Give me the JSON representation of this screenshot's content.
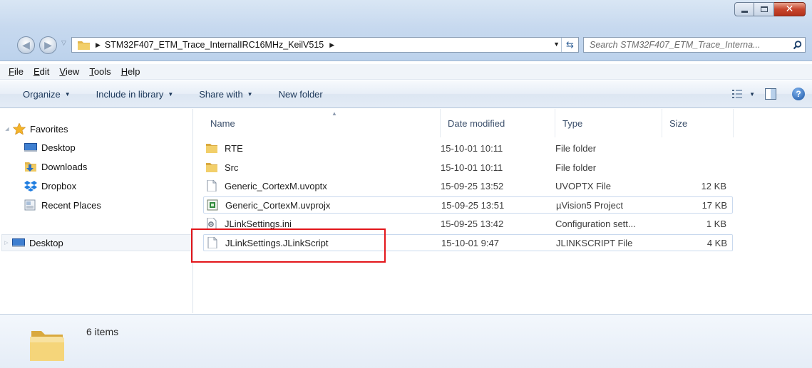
{
  "window": {
    "breadcrumb": [
      "STM32F407_ETM_Trace_InternalIRC16MHz_KeilV515"
    ],
    "search_placeholder": "Search STM32F407_ETM_Trace_Interna..."
  },
  "menu": {
    "file": "F",
    "file_rest": "ile",
    "edit": "E",
    "edit_rest": "dit",
    "view": "V",
    "view_rest": "iew",
    "tools": "T",
    "tools_rest": "ools",
    "help": "H",
    "help_rest": "elp"
  },
  "commands": {
    "organize": "Organize",
    "include": "Include in library",
    "share": "Share with",
    "new_folder": "New folder"
  },
  "nav": {
    "favorites": "Favorites",
    "desktop": "Desktop",
    "downloads": "Downloads",
    "dropbox": "Dropbox",
    "recent": "Recent Places",
    "desktop_root": "Desktop"
  },
  "columns": {
    "name": "Name",
    "date": "Date modified",
    "type": "Type",
    "size": "Size"
  },
  "files": [
    {
      "name": "RTE",
      "date": "15-10-01 10:11",
      "type": "File folder",
      "size": "",
      "icon": "folder-icon"
    },
    {
      "name": "Src",
      "date": "15-10-01 10:11",
      "type": "File folder",
      "size": "",
      "icon": "folder-icon"
    },
    {
      "name": "Generic_CortexM.uvoptx",
      "date": "15-09-25 13:52",
      "type": "UVOPTX File",
      "size": "12 KB",
      "icon": "document-icon"
    },
    {
      "name": "Generic_CortexM.uvprojx",
      "date": "15-09-25 13:51",
      "type": "µVision5 Project",
      "size": "17 KB",
      "icon": "uvision-project-icon"
    },
    {
      "name": "JLinkSettings.ini",
      "date": "15-09-25 13:42",
      "type": "Configuration sett...",
      "size": "1 KB",
      "icon": "settings-file-icon"
    },
    {
      "name": "JLinkSettings.JLinkScript",
      "date": "15-10-01 9:47",
      "type": "JLINKSCRIPT File",
      "size": "4 KB",
      "icon": "document-icon"
    }
  ],
  "status": {
    "count": "6 items"
  }
}
